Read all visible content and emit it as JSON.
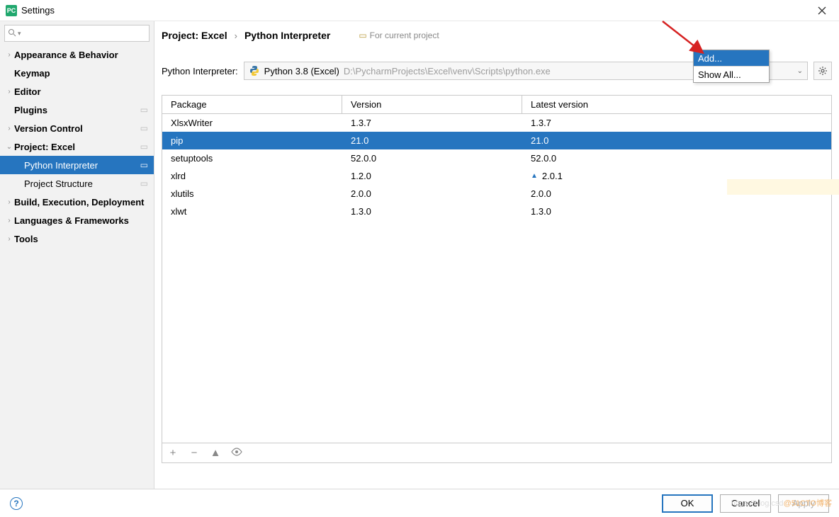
{
  "title": "Settings",
  "sidebar": {
    "items": [
      {
        "label": "Appearance & Behavior",
        "arrow": ">",
        "bold": true,
        "copy": false
      },
      {
        "label": "Keymap",
        "arrow": "",
        "bold": true,
        "copy": false
      },
      {
        "label": "Editor",
        "arrow": ">",
        "bold": true,
        "copy": false
      },
      {
        "label": "Plugins",
        "arrow": "",
        "bold": true,
        "copy": true
      },
      {
        "label": "Version Control",
        "arrow": ">",
        "bold": true,
        "copy": true
      },
      {
        "label": "Project: Excel",
        "arrow": "v",
        "bold": true,
        "copy": true
      },
      {
        "label": "Python Interpreter",
        "arrow": "",
        "bold": false,
        "copy": true,
        "sub": true,
        "selected": true
      },
      {
        "label": "Project Structure",
        "arrow": "",
        "bold": false,
        "copy": true,
        "sub": true
      },
      {
        "label": "Build, Execution, Deployment",
        "arrow": ">",
        "bold": true,
        "copy": false
      },
      {
        "label": "Languages & Frameworks",
        "arrow": ">",
        "bold": true,
        "copy": false
      },
      {
        "label": "Tools",
        "arrow": ">",
        "bold": true,
        "copy": false
      }
    ]
  },
  "breadcrumb": {
    "project": "Project: Excel",
    "sep": "›",
    "page": "Python Interpreter",
    "note": "For current project"
  },
  "interpreter": {
    "label": "Python Interpreter:",
    "name": "Python 3.8 (Excel)",
    "path": "D:\\PycharmProjects\\Excel\\venv\\Scripts\\python.exe"
  },
  "table": {
    "headers": {
      "pkg": "Package",
      "ver": "Version",
      "lat": "Latest version"
    },
    "rows": [
      {
        "pkg": "XlsxWriter",
        "ver": "1.3.7",
        "lat": "1.3.7",
        "up": false
      },
      {
        "pkg": "pip",
        "ver": "21.0",
        "lat": "21.0",
        "up": false,
        "selected": true
      },
      {
        "pkg": "setuptools",
        "ver": "52.0.0",
        "lat": "52.0.0",
        "up": false
      },
      {
        "pkg": "xlrd",
        "ver": "1.2.0",
        "lat": "2.0.1",
        "up": true
      },
      {
        "pkg": "xlutils",
        "ver": "2.0.0",
        "lat": "2.0.0",
        "up": false
      },
      {
        "pkg": "xlwt",
        "ver": "1.3.0",
        "lat": "1.3.0",
        "up": false
      }
    ]
  },
  "gear_menu": {
    "add": "Add...",
    "show_all": "Show All..."
  },
  "buttons": {
    "ok": "OK",
    "cancel": "Cancel",
    "apply": "Apply"
  },
  "watermark": {
    "a": "https://blog.csd",
    "b": "@51CTO博客"
  }
}
